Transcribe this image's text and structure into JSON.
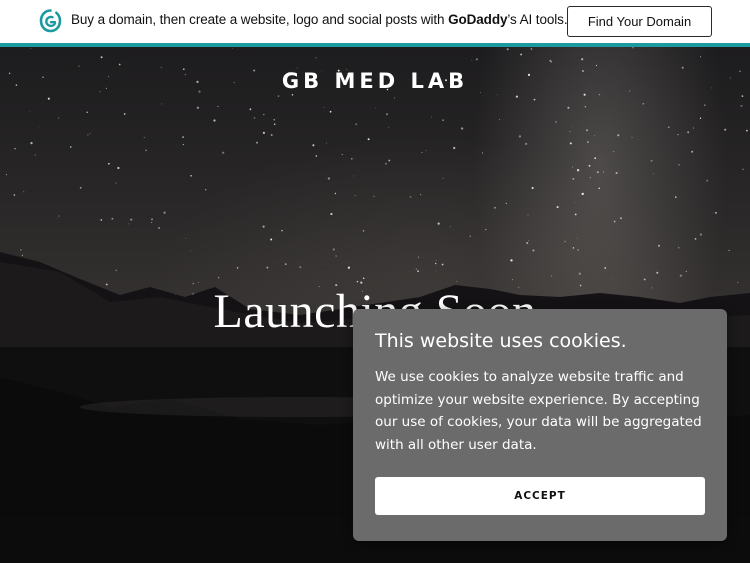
{
  "promo": {
    "text_prefix": "Buy a domain, then create a website, logo and social posts with ",
    "brand": "GoDaddy",
    "text_suffix": "’s AI tools.",
    "button_label": "Find Your Domain",
    "accent_color": "#1c9aa0",
    "logo_icon": "godaddy-logo-icon"
  },
  "hero": {
    "site_title": "GB MED LAB",
    "headline": "Launching Soon",
    "background": "night-sky-milky-way-mountains-lake"
  },
  "cookie_dialog": {
    "title": "This website uses cookies.",
    "body": "We use cookies to analyze website traffic and optimize your website experience. By accepting our use of cookies, your data will be aggregated with all other user data.",
    "accept_label": "ACCEPT",
    "panel_color": "#6b6b6b"
  }
}
